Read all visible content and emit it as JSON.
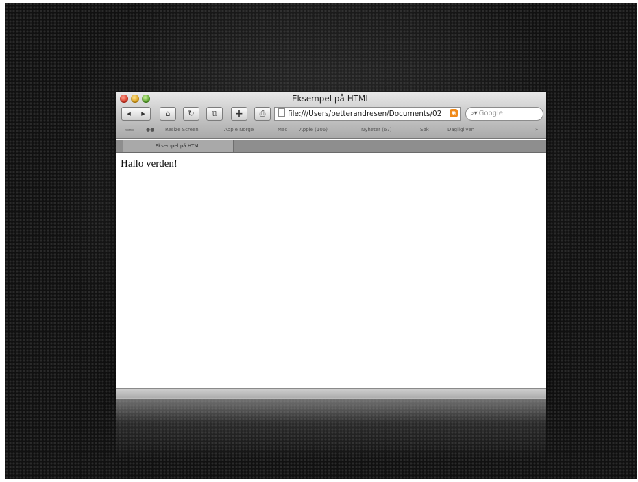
{
  "window": {
    "title": "Eksempel på HTML"
  },
  "toolbar": {
    "back_icon": "◂",
    "forward_icon": "▸",
    "home_icon": "⌂",
    "reload_icon": "↻",
    "tabs_icon": "⧉",
    "add_icon": "+",
    "print_icon": "⎙"
  },
  "address": {
    "value": "file:///Users/petterandresen/Documents/02"
  },
  "search": {
    "placeholder": "Google"
  },
  "bookmarks": {
    "items": [
      "Resize Screen",
      "Apple Norge",
      "Mac",
      "Apple (106)",
      "Nyheter (67)",
      "Søk",
      "Dagligliven"
    ],
    "overflow": "»"
  },
  "tab": {
    "label": "Eksempel på HTML"
  },
  "content": {
    "text": "Hallo verden!"
  },
  "colors": {
    "background": "#111111",
    "rss_orange": "#f08a1a"
  }
}
